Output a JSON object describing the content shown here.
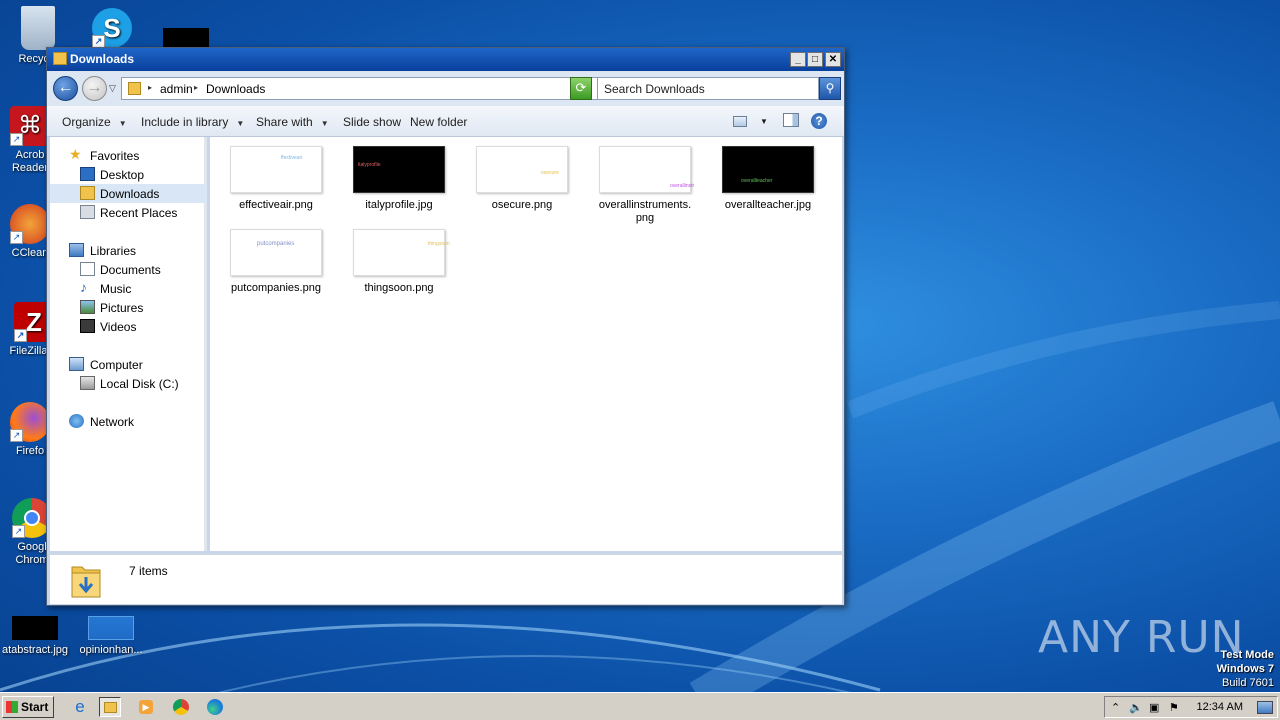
{
  "desktop": {
    "icons": [
      {
        "label": "Recycle"
      },
      {
        "label": "Acrob\nReader"
      },
      {
        "label": "CClean"
      },
      {
        "label": "FileZilla C"
      },
      {
        "label": "Firefo"
      },
      {
        "label": "Googl\nChrom"
      },
      {
        "label": "atabstract.jpg"
      },
      {
        "label": "opinionhan..."
      }
    ]
  },
  "window": {
    "title": "Downloads",
    "breadcrumb": [
      "admin",
      "Downloads"
    ],
    "search_placeholder": "Search Downloads",
    "toolbar": {
      "organize": "Organize",
      "include_in_library": "Include in library",
      "share_with": "Share with",
      "slide_show": "Slide show",
      "new_folder": "New folder"
    },
    "nav": {
      "favorites": "Favorites",
      "desktop": "Desktop",
      "downloads": "Downloads",
      "recent_places": "Recent Places",
      "libraries": "Libraries",
      "documents": "Documents",
      "music": "Music",
      "pictures": "Pictures",
      "videos": "Videos",
      "computer": "Computer",
      "local_disk": "Local Disk (C:)",
      "network": "Network"
    },
    "files": [
      {
        "name": "effectiveair.png",
        "thumb_text": "ffectiveair",
        "dark": false,
        "text_color": "#7ab8e0"
      },
      {
        "name": "italyprofile.jpg",
        "thumb_text": "italyprofile",
        "dark": true,
        "text_color": "#e06060"
      },
      {
        "name": "osecure.png",
        "thumb_text": "osecure",
        "dark": false,
        "text_color": "#e8c040"
      },
      {
        "name": "overallinstruments.\npng",
        "thumb_text": "overallinstr",
        "dark": false,
        "text_color": "#c050e0"
      },
      {
        "name": "overallteacher.jpg",
        "thumb_text": "overallteacher",
        "dark": true,
        "text_color": "#60c060"
      },
      {
        "name": "putcompanies.png",
        "thumb_text": "putcompanies",
        "dark": false,
        "text_color": "#8090c8"
      },
      {
        "name": "thingsoon.png",
        "thumb_text": "thingsoon",
        "dark": false,
        "text_color": "#e0c060"
      }
    ],
    "status": "7 items"
  },
  "taskbar": {
    "start": "Start",
    "clock": "12:34 AM"
  },
  "watermark": {
    "brand": "ANY RUN",
    "line1": "Test Mode",
    "line2": "Windows 7",
    "line3": "Build 7601"
  }
}
